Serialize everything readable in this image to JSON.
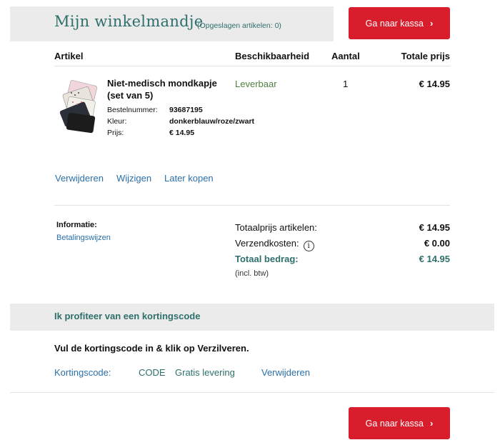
{
  "header": {
    "title": "Mijn winkelmandje",
    "saved_note": "(Opgeslagen artikelen: 0)",
    "checkout_label": "Ga naar kassa"
  },
  "table": {
    "columns": [
      "Artikel",
      "Beschikbaarheid",
      "Aantal",
      "Totale prijs"
    ]
  },
  "item": {
    "name": "Niet-medisch mondkapje (set van 5)",
    "order_number_label": "Bestelnummer:",
    "order_number": "93687195",
    "color_label": "Kleur:",
    "color": "donkerblauw/roze/zwart",
    "price_label": "Prijs:",
    "price": "€ 14.95",
    "availability": "Leverbaar",
    "quantity": "1",
    "total": "€ 14.95",
    "actions": [
      "Verwijderen",
      "Wijzigen",
      "Later kopen"
    ]
  },
  "info": {
    "label": "Informatie:",
    "link": "Betalingswijzen"
  },
  "summary": {
    "items_label": "Totaalprijs artikelen:",
    "items_value": "€ 14.95",
    "shipping_label": "Verzendkosten:",
    "shipping_value": "€ 0.00",
    "total_label": "Totaal bedrag:",
    "total_value": "€ 14.95",
    "vat_note": "(incl. btw)"
  },
  "discount": {
    "title": "Ik profiteer van een kortingscode",
    "instruction": "Vul de kortingscode in & klik op Verzilveren.",
    "code_label": "Kortingscode:",
    "code": "CODE",
    "code_description": "Gratis levering",
    "remove_label": "Verwijderen"
  },
  "colors": {
    "accent_teal": "#2e6f6b",
    "checkout_red": "#d81e2c",
    "link_blue": "#2a6fa8",
    "availability_green": "#4f7f3f"
  }
}
